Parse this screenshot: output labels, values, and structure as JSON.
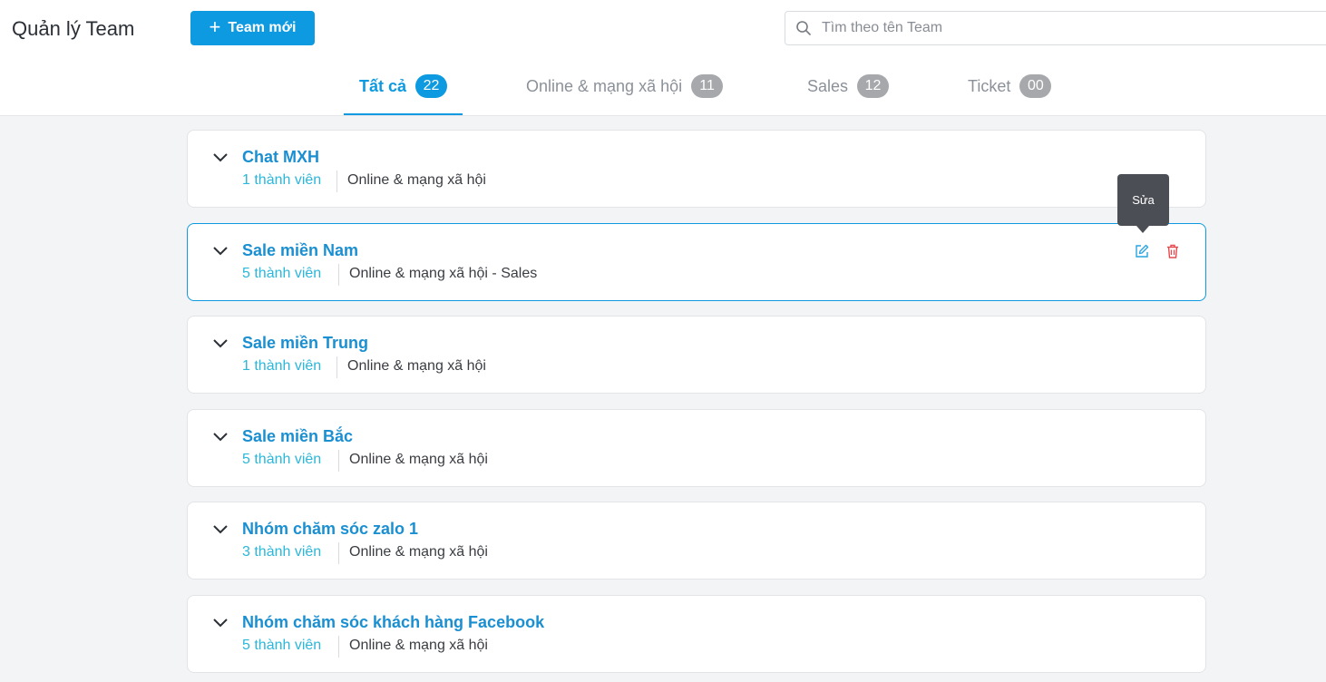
{
  "header": {
    "title": "Quản lý Team",
    "new_team_label": "Team mới",
    "search_placeholder": "Tìm theo tên Team"
  },
  "tabs": [
    {
      "label": "Tất cả",
      "count": "22",
      "active": true
    },
    {
      "label": "Online & mạng xã hội",
      "count": "11",
      "active": false
    },
    {
      "label": "Sales",
      "count": "12",
      "active": false
    },
    {
      "label": "Ticket",
      "count": "00",
      "active": false
    }
  ],
  "teams": [
    {
      "name": "Chat MXH",
      "members": "1 thành viên",
      "channels": "Online & mạng xã hội"
    },
    {
      "name": "Sale miền Nam",
      "members": "5 thành viên",
      "channels": "Online & mạng xã hội - Sales"
    },
    {
      "name": "Sale miền Trung",
      "members": "1 thành viên",
      "channels": "Online & mạng xã hội"
    },
    {
      "name": "Sale miền Bắc",
      "members": "5 thành viên",
      "channels": "Online & mạng xã hội"
    },
    {
      "name": "Nhóm chăm sóc zalo 1",
      "members": "3 thành viên",
      "channels": "Online & mạng xã hội"
    },
    {
      "name": "Nhóm chăm sóc khách hàng Facebook",
      "members": "5 thành viên",
      "channels": "Online & mạng xã hội"
    }
  ],
  "tooltip": {
    "label": "Sửa"
  },
  "icons": {
    "plus": "plus-icon",
    "search": "search-icon",
    "chevron": "chevron-down-icon",
    "edit": "edit-icon",
    "delete": "trash-icon"
  },
  "colors": {
    "accent": "#0d9ae0",
    "member_count": "#2bb7d9",
    "delete": "#e5484d",
    "badge_inactive": "#a6a8ab"
  }
}
